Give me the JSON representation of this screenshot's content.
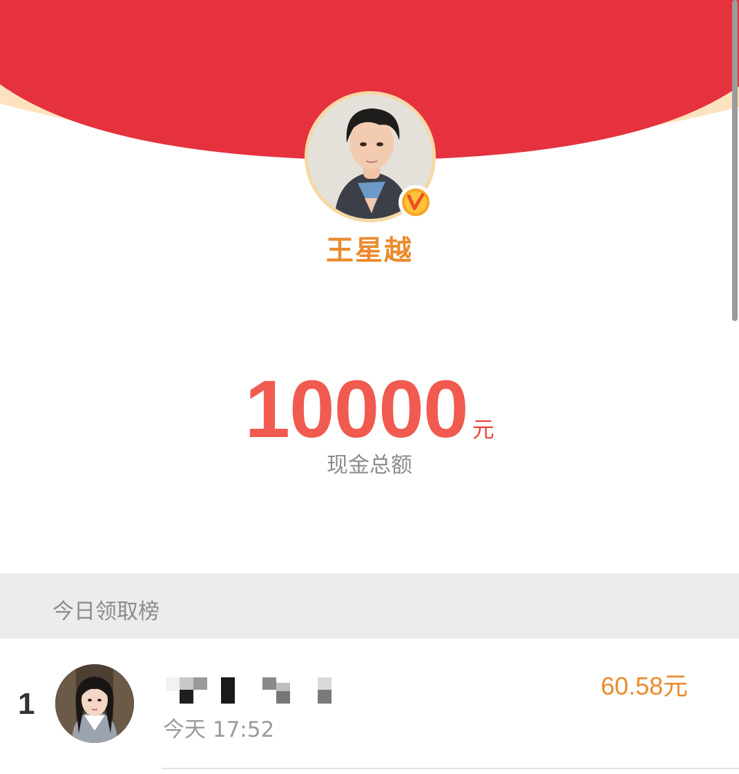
{
  "profile": {
    "name": "王星越",
    "avatar_icon": "user-portrait-icon",
    "badge_icon": "verified-v-badge-icon"
  },
  "redpacket": {
    "amount": "10000",
    "unit": "元",
    "caption": "现金总额"
  },
  "leaderboard": {
    "title": "今日领取榜",
    "entries": [
      {
        "rank": "1",
        "name": "",
        "name_masked": true,
        "time": "今天 17:52",
        "amount": "60.58元"
      }
    ]
  },
  "colors": {
    "header_red": "#e5323e",
    "header_rim": "#fde2bf",
    "name_orange": "#ec8a2d",
    "amount_red": "#f05a4f",
    "section_gray": "#ececec"
  }
}
